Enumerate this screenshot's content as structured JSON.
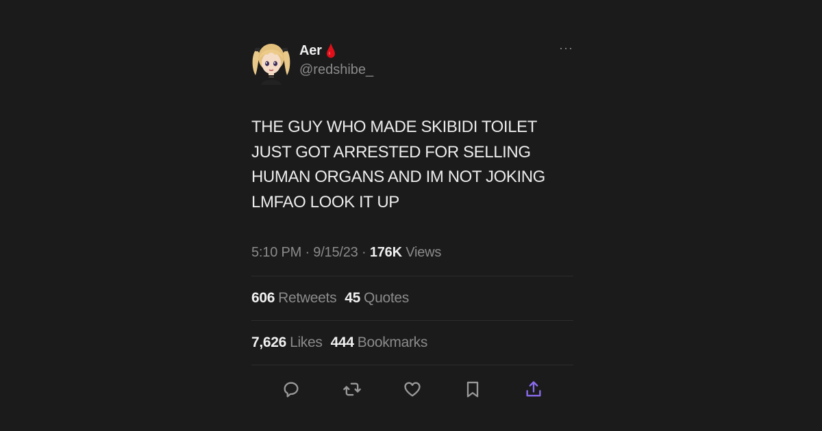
{
  "author": {
    "display_name": "Aer",
    "handle": "@redshibe_",
    "badge_icon": "blood-drop-icon",
    "badge_color": "#e0101a"
  },
  "menu": {
    "more_label": "···"
  },
  "tweet": {
    "text": "THE GUY WHO MADE SKIBIDI TOILET JUST GOT ARRESTED FOR SELLING HUMAN ORGANS AND IM NOT JOKING LMFAO LOOK IT UP",
    "time": "5:10 PM",
    "separator": "·",
    "date": "9/15/23",
    "views_count": "176K",
    "views_label": "Views"
  },
  "stats": {
    "retweets_count": "606",
    "retweets_label": "Retweets",
    "quotes_count": "45",
    "quotes_label": "Quotes",
    "likes_count": "7,626",
    "likes_label": "Likes",
    "bookmarks_count": "444",
    "bookmarks_label": "Bookmarks"
  },
  "actions": [
    {
      "icon": "reply-icon"
    },
    {
      "icon": "retweet-icon"
    },
    {
      "icon": "like-heart-icon"
    },
    {
      "icon": "bookmark-icon"
    },
    {
      "icon": "share-icon",
      "color": "#8b6cf0"
    }
  ],
  "colors": {
    "background": "#1b1b1b",
    "text_primary": "#ececec",
    "text_secondary": "#8b8b8b",
    "accent": "#8b6cf0"
  }
}
